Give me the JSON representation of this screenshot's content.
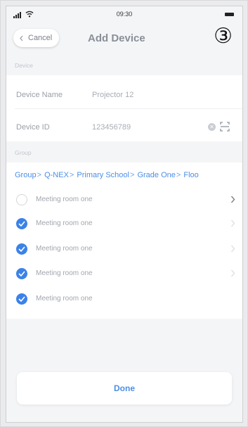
{
  "status_bar": {
    "time": "09:30"
  },
  "nav": {
    "back_label": "Cancel",
    "title": "Add Device",
    "step_badge": "③"
  },
  "device_section": {
    "label": "Device",
    "name_label": "Device Name",
    "name_value": "Projector 12",
    "id_label": "Device ID",
    "id_value": "123456789"
  },
  "group_section": {
    "label": "Group",
    "breadcrumb": [
      "Group",
      "Q-NEX",
      "Primary School",
      "Grade One",
      "Floo"
    ],
    "items": [
      {
        "label": "Meeting room one",
        "checked": false
      },
      {
        "label": "Meeting room one",
        "checked": true
      },
      {
        "label": "Meeting room one",
        "checked": true
      },
      {
        "label": "Meeting room one",
        "checked": true
      },
      {
        "label": "Meeting room one",
        "checked": true
      }
    ]
  },
  "footer": {
    "done_label": "Done"
  },
  "icons": {
    "back": "chevron-left-icon",
    "clear": "clear-circle-icon",
    "scan": "scan-icon",
    "chevron": "chevron-right-icon",
    "check": "checkmark-icon"
  },
  "colors": {
    "accent": "#3b82e8",
    "link": "#4b8fe6",
    "background": "#f4f5f7"
  }
}
